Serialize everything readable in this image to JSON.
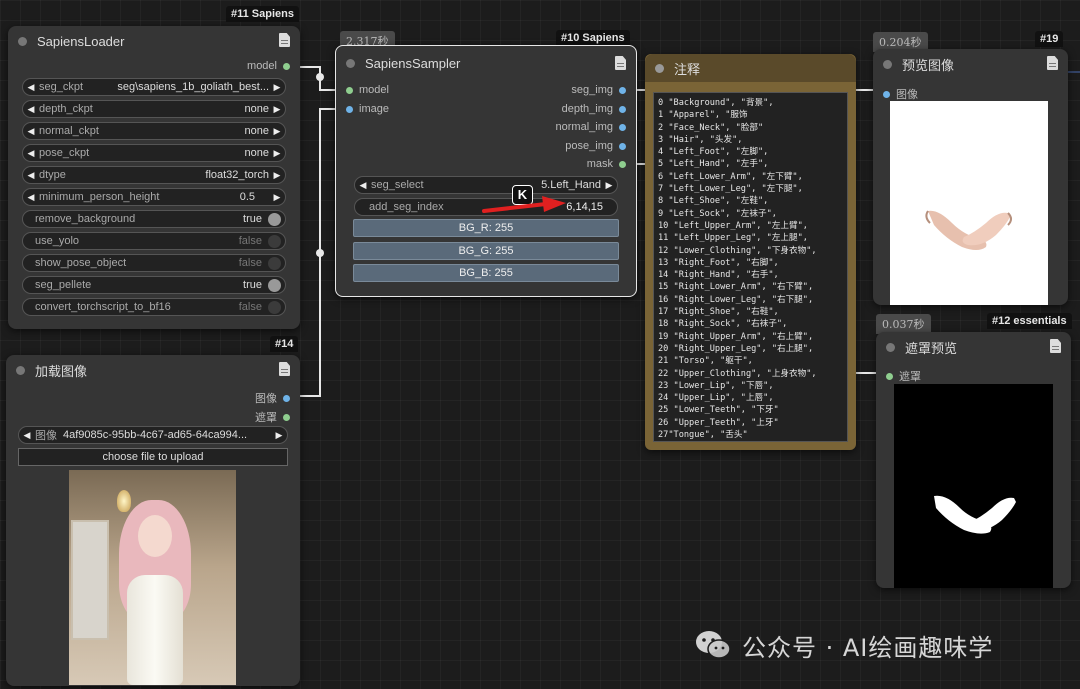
{
  "loader": {
    "badge": "#11 Sapiens",
    "title": "SapiensLoader",
    "output_model": "model",
    "widgets": [
      {
        "label": "seg_ckpt",
        "value": "seg\\sapiens_1b_goliath_best..."
      },
      {
        "label": "depth_ckpt",
        "value": "none"
      },
      {
        "label": "normal_ckpt",
        "value": "none"
      },
      {
        "label": "pose_ckpt",
        "value": "none"
      },
      {
        "label": "dtype",
        "value": "float32_torch"
      },
      {
        "label": "minimum_person_height",
        "value": "0.5"
      }
    ],
    "toggles": [
      {
        "label": "remove_background",
        "value": "true"
      },
      {
        "label": "use_yolo",
        "value": "false"
      },
      {
        "label": "show_pose_object",
        "value": "false"
      },
      {
        "label": "seg_pellete",
        "value": "true"
      },
      {
        "label": "convert_torchscript_to_bf16",
        "value": "false"
      }
    ]
  },
  "load_image": {
    "badge": "#14",
    "title": "加载图像",
    "output_image": "图像",
    "output_mask": "遮罩",
    "image_label": "图像",
    "image_value": "4af9085c-95bb-4c67-ad65-64ca994...",
    "upload_button": "choose file to upload"
  },
  "sampler": {
    "timer": "2.317秒",
    "badge": "#10 Sapiens",
    "title": "SapiensSampler",
    "inputs": [
      "model",
      "image"
    ],
    "outputs": [
      "seg_img",
      "depth_img",
      "normal_img",
      "pose_img",
      "mask"
    ],
    "seg_select_label": "seg_select",
    "seg_select_value": "5.Left_Hand",
    "add_seg_index_label": "add_seg_index",
    "add_seg_index_value": "6,14,15",
    "bg_r": "BG_R: 255",
    "bg_g": "BG_G: 255",
    "bg_b": "BG_B: 255"
  },
  "note": {
    "title": "注释",
    "lines": [
      "0 \"Background\", \"背景\",",
      "1 \"Apparel\", \"服饰",
      "2 \"Face_Neck\", \"脸部\"",
      "3 \"Hair\", \"头发\",",
      "4 \"Left_Foot\", \"左脚\",",
      "5 \"Left_Hand\", \"左手\",",
      "6 \"Left_Lower_Arm\", \"左下臂\",",
      "7 \"Left_Lower_Leg\", \"左下腿\",",
      "8 \"Left_Shoe\", \"左鞋\",",
      "9 \"Left_Sock\", \"左袜子\",",
      "10 \"Left_Upper_Arm\", \"左上臂\",",
      "11 \"Left_Upper_Leg\", \"左上腿\",",
      "12 \"Lower_Clothing\", \"下身衣物\",",
      "13 \"Right_Foot\", \"右脚\",",
      "14 \"Right_Hand\", \"右手\",",
      "15 \"Right_Lower_Arm\", \"右下臂\",",
      "16 \"Right_Lower_Leg\", \"右下腿\",",
      "17 \"Right_Shoe\", \"右鞋\",",
      "18 \"Right_Sock\", \"右袜子\",",
      "19 \"Right_Upper_Arm\", \"右上臂\",",
      "20 \"Right_Upper_Leg\", \"右上腿\",",
      "21 \"Torso\", \"躯干\",",
      "22 \"Upper_Clothing\", \"上身衣物\",",
      "23 \"Lower_Lip\", \"下唇\",",
      "24 \"Upper_Lip\", \"上唇\",",
      "25 \"Lower_Teeth\", \"下牙\"",
      "26 \"Upper_Teeth\", \"上牙\"",
      "27\"Tongue\", \"舌头\""
    ]
  },
  "preview": {
    "timer": "0.204秒",
    "badge": "#19",
    "title": "预览图像",
    "input_label": "图像"
  },
  "mask_preview": {
    "timer": "0.037秒",
    "badge": "#12 essentials",
    "title": "遮罩预览",
    "input_label": "遮罩"
  },
  "watermark": {
    "text": "公众号 · AI绘画趣味学"
  },
  "colors": {
    "canvas_bg": "#1c1c1c",
    "node_bg": "#353535",
    "note_border": "#7a6436",
    "slot_green": "#8fce8f",
    "slot_blue": "#6fb3e8",
    "annotation_arrow": "#e02020"
  }
}
